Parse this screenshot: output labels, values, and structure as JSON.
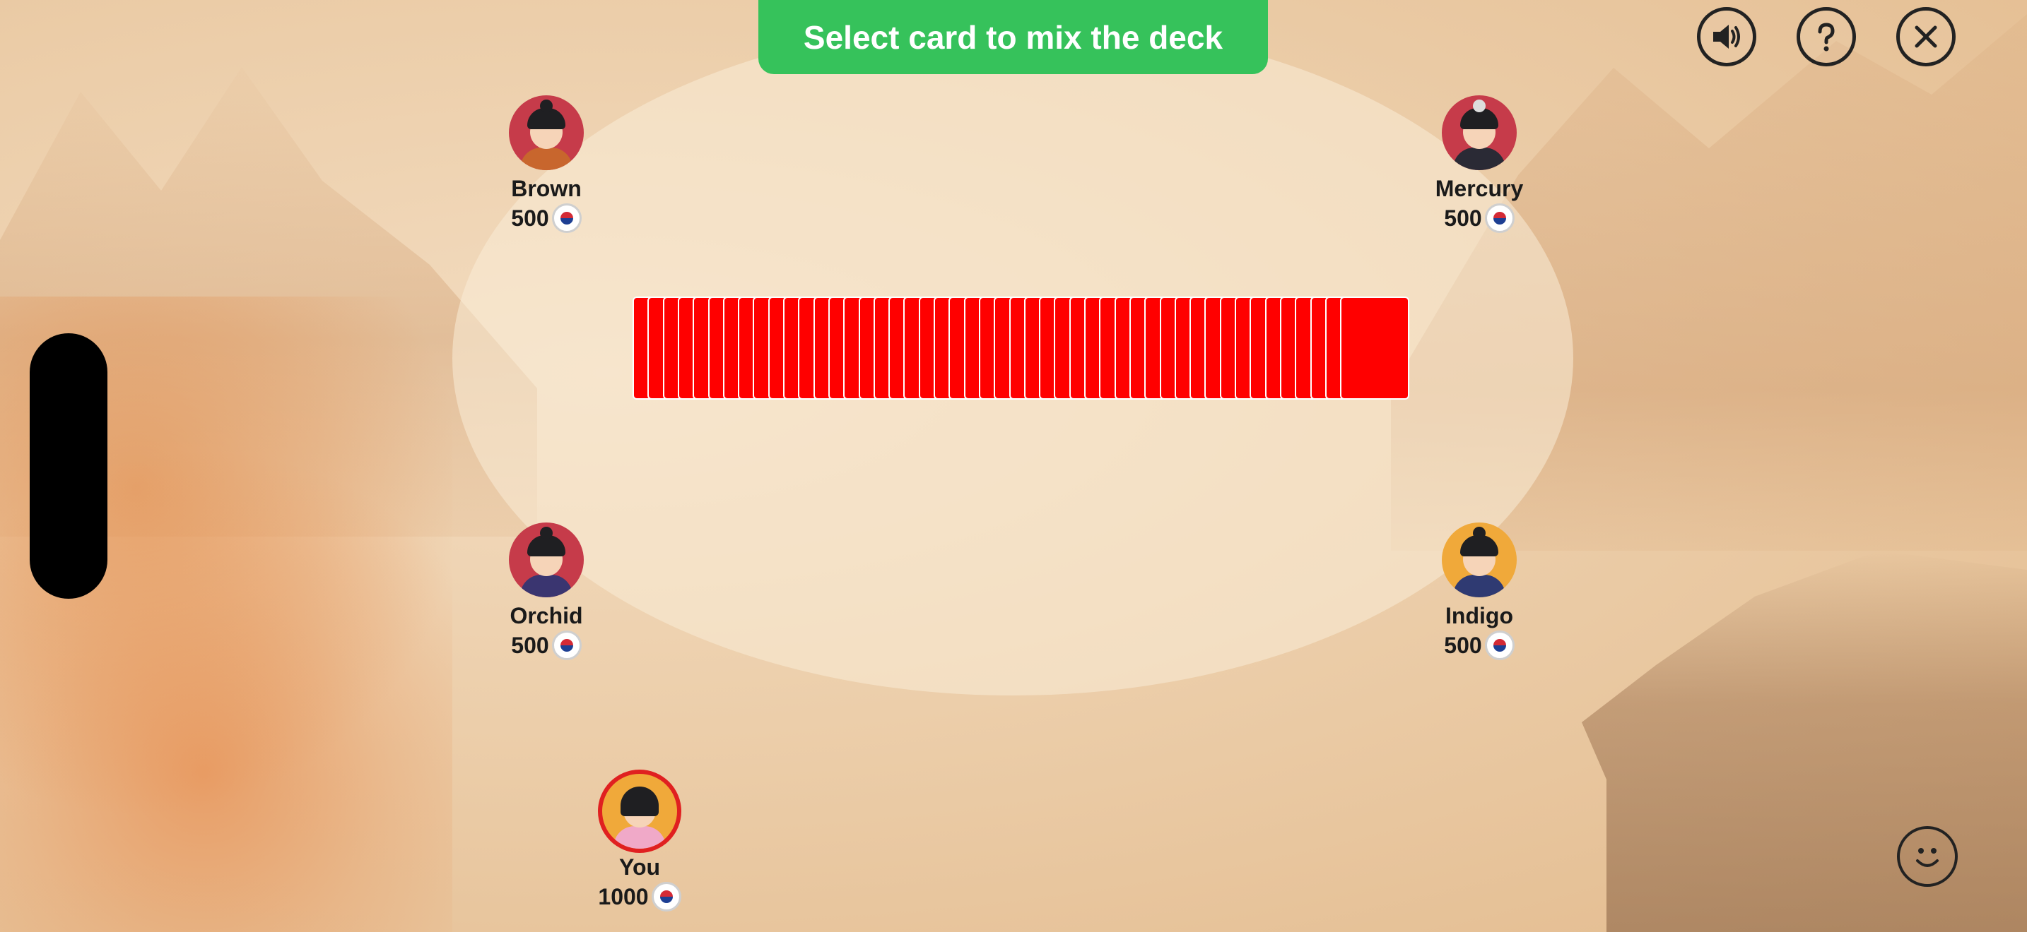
{
  "banner": {
    "text": "Select card to mix the deck"
  },
  "toolbar": {
    "sound_icon": "speaker-icon",
    "help_icon": "question-icon",
    "close_icon": "close-icon"
  },
  "players": {
    "brown": {
      "name": "Brown",
      "balance": "500"
    },
    "mercury": {
      "name": "Mercury",
      "balance": "500"
    },
    "orchid": {
      "name": "Orchid",
      "balance": "500"
    },
    "indigo": {
      "name": "Indigo",
      "balance": "500"
    },
    "you": {
      "name": "You",
      "balance": "1000"
    }
  },
  "deck": {
    "card_count": 48,
    "card_back_color": "#ff0000"
  },
  "colors": {
    "banner_green": "#36c25b",
    "avatar_red": "#c63b4a",
    "avatar_gold": "#f0a93a",
    "active_ring": "#e02020"
  },
  "emoji_button": {
    "icon": "smiley-icon"
  }
}
